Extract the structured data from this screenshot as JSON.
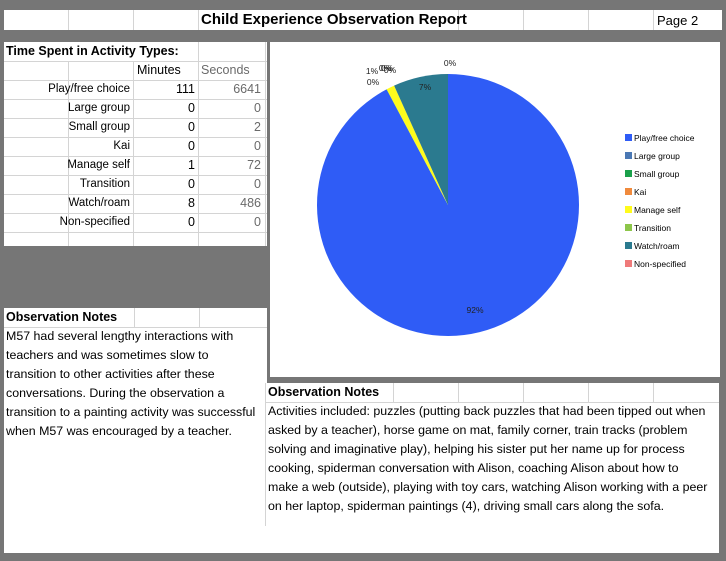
{
  "header": {
    "title": "Child Experience Observation Report",
    "page": "Page 2"
  },
  "activity_table": {
    "heading": "Time Spent in Activity Types:",
    "columns": [
      "Minutes",
      "Seconds"
    ],
    "rows": [
      {
        "label": "Play/free choice",
        "minutes": "111",
        "seconds": "6641"
      },
      {
        "label": "Large group",
        "minutes": "0",
        "seconds": "0"
      },
      {
        "label": "Small group",
        "minutes": "0",
        "seconds": "2"
      },
      {
        "label": "Kai",
        "minutes": "0",
        "seconds": "0"
      },
      {
        "label": "Manage self",
        "minutes": "1",
        "seconds": "72"
      },
      {
        "label": "Transition",
        "minutes": "0",
        "seconds": "0"
      },
      {
        "label": "Watch/roam",
        "minutes": "8",
        "seconds": "486"
      },
      {
        "label": "Non-specified",
        "minutes": "0",
        "seconds": "0"
      }
    ]
  },
  "notes_left": {
    "heading": "Observation Notes",
    "lines": [
      "M57 had several lengthy interactions with",
      "teachers and was sometimes slow to",
      "transition to other activities after these",
      "conversations.  During the observation a",
      "transition to a painting activity was successful",
      "when M57 was encouraged by a teacher."
    ]
  },
  "notes_right": {
    "heading": "Observation Notes",
    "lines": [
      "Activities included: puzzles (putting back puzzles that had been tipped out when",
      "asked by a teacher), horse game on mat, family corner, train tracks (problem",
      "solving and imaginative play), helping his sister put her name up for process",
      "cooking, spiderman conversation with Alison, coaching Alison about how to",
      "make a web (outside), playing with toy cars, watching Alison working with a peer",
      "on her laptop, spiderman paintings (4), driving small cars along the sofa."
    ]
  },
  "chart_data": {
    "type": "pie",
    "title": "",
    "legend_position": "right",
    "categories": [
      "Play/free choice",
      "Large group",
      "Small group",
      "Kai",
      "Manage self",
      "Transition",
      "Watch/roam",
      "Non-specified"
    ],
    "values": [
      6641,
      0,
      2,
      0,
      72,
      0,
      486,
      0
    ],
    "labels": [
      "92%",
      "0%",
      "0%",
      "0%",
      "1%",
      "0%",
      "7%",
      "0%"
    ],
    "colors": [
      "#2f5cf6",
      "#4a78b4",
      "#1aa04a",
      "#f08a3c",
      "#fffb1c",
      "#8dc64a",
      "#2b7a8f",
      "#ef7a7a"
    ]
  }
}
